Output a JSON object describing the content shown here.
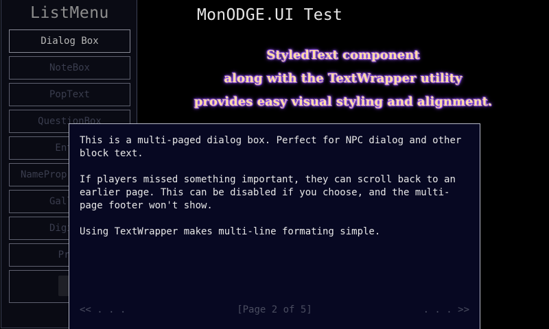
{
  "list_menu": {
    "title": "ListMenu",
    "items": [
      {
        "label": "Dialog Box"
      },
      {
        "label": "NoteBox"
      },
      {
        "label": "PopText"
      },
      {
        "label": "QuestionBox"
      },
      {
        "label": "Entry"
      },
      {
        "label": "NameProp"
      },
      {
        "label": "Gallery"
      },
      {
        "label": "Digit S"
      },
      {
        "label": "Prop"
      },
      {
        "label": ""
      }
    ]
  },
  "header": {
    "title": "MonODGE.UI Test"
  },
  "styled_text": {
    "line1": "StyledText component",
    "line2": "along with the TextWrapper utility",
    "line3": "provides easy visual styling and alignment."
  },
  "dialog": {
    "para1": "This is a multi-paged dialog box. Perfect for NPC dialog and other block text.",
    "para2": "If players missed something important, they can scroll back to an earlier page. This can be disabled if you choose, and the multi-page footer won't show.",
    "para3": "Using TextWrapper makes multi-line formating simple.",
    "footer": {
      "prev": "<< . . .",
      "page": "[Page 2 of 5]",
      "next": ". . . >>"
    }
  },
  "colors": {
    "background": "#000000",
    "dialog_bg": "#070822",
    "styled_text_fill": "#ffdca6",
    "styled_text_glow": "#9c5bff"
  }
}
